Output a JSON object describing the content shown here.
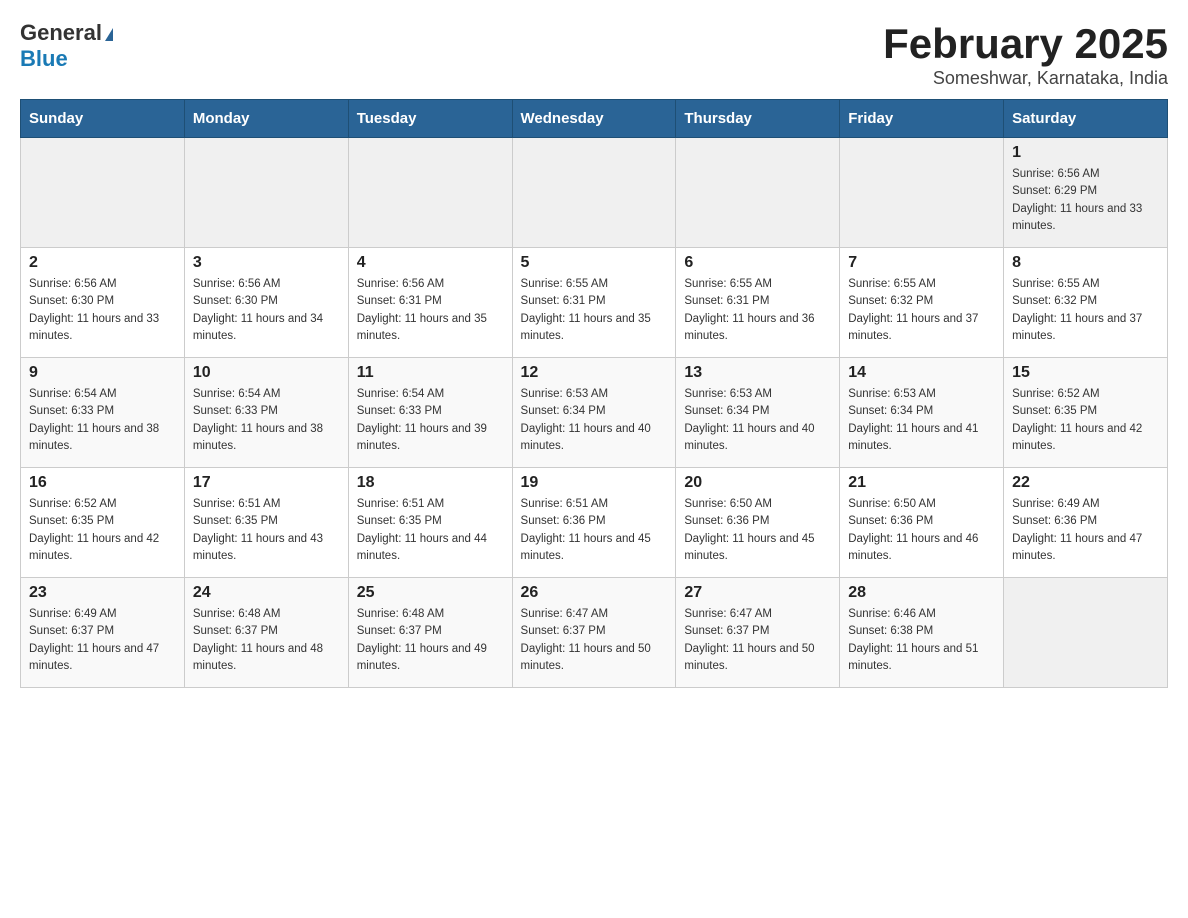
{
  "logo": {
    "general": "General",
    "blue": "Blue"
  },
  "title": "February 2025",
  "location": "Someshwar, Karnataka, India",
  "days_of_week": [
    "Sunday",
    "Monday",
    "Tuesday",
    "Wednesday",
    "Thursday",
    "Friday",
    "Saturday"
  ],
  "weeks": [
    [
      {
        "num": "",
        "info": ""
      },
      {
        "num": "",
        "info": ""
      },
      {
        "num": "",
        "info": ""
      },
      {
        "num": "",
        "info": ""
      },
      {
        "num": "",
        "info": ""
      },
      {
        "num": "",
        "info": ""
      },
      {
        "num": "1",
        "info": "Sunrise: 6:56 AM\nSunset: 6:29 PM\nDaylight: 11 hours and 33 minutes."
      }
    ],
    [
      {
        "num": "2",
        "info": "Sunrise: 6:56 AM\nSunset: 6:30 PM\nDaylight: 11 hours and 33 minutes."
      },
      {
        "num": "3",
        "info": "Sunrise: 6:56 AM\nSunset: 6:30 PM\nDaylight: 11 hours and 34 minutes."
      },
      {
        "num": "4",
        "info": "Sunrise: 6:56 AM\nSunset: 6:31 PM\nDaylight: 11 hours and 35 minutes."
      },
      {
        "num": "5",
        "info": "Sunrise: 6:55 AM\nSunset: 6:31 PM\nDaylight: 11 hours and 35 minutes."
      },
      {
        "num": "6",
        "info": "Sunrise: 6:55 AM\nSunset: 6:31 PM\nDaylight: 11 hours and 36 minutes."
      },
      {
        "num": "7",
        "info": "Sunrise: 6:55 AM\nSunset: 6:32 PM\nDaylight: 11 hours and 37 minutes."
      },
      {
        "num": "8",
        "info": "Sunrise: 6:55 AM\nSunset: 6:32 PM\nDaylight: 11 hours and 37 minutes."
      }
    ],
    [
      {
        "num": "9",
        "info": "Sunrise: 6:54 AM\nSunset: 6:33 PM\nDaylight: 11 hours and 38 minutes."
      },
      {
        "num": "10",
        "info": "Sunrise: 6:54 AM\nSunset: 6:33 PM\nDaylight: 11 hours and 38 minutes."
      },
      {
        "num": "11",
        "info": "Sunrise: 6:54 AM\nSunset: 6:33 PM\nDaylight: 11 hours and 39 minutes."
      },
      {
        "num": "12",
        "info": "Sunrise: 6:53 AM\nSunset: 6:34 PM\nDaylight: 11 hours and 40 minutes."
      },
      {
        "num": "13",
        "info": "Sunrise: 6:53 AM\nSunset: 6:34 PM\nDaylight: 11 hours and 40 minutes."
      },
      {
        "num": "14",
        "info": "Sunrise: 6:53 AM\nSunset: 6:34 PM\nDaylight: 11 hours and 41 minutes."
      },
      {
        "num": "15",
        "info": "Sunrise: 6:52 AM\nSunset: 6:35 PM\nDaylight: 11 hours and 42 minutes."
      }
    ],
    [
      {
        "num": "16",
        "info": "Sunrise: 6:52 AM\nSunset: 6:35 PM\nDaylight: 11 hours and 42 minutes."
      },
      {
        "num": "17",
        "info": "Sunrise: 6:51 AM\nSunset: 6:35 PM\nDaylight: 11 hours and 43 minutes."
      },
      {
        "num": "18",
        "info": "Sunrise: 6:51 AM\nSunset: 6:35 PM\nDaylight: 11 hours and 44 minutes."
      },
      {
        "num": "19",
        "info": "Sunrise: 6:51 AM\nSunset: 6:36 PM\nDaylight: 11 hours and 45 minutes."
      },
      {
        "num": "20",
        "info": "Sunrise: 6:50 AM\nSunset: 6:36 PM\nDaylight: 11 hours and 45 minutes."
      },
      {
        "num": "21",
        "info": "Sunrise: 6:50 AM\nSunset: 6:36 PM\nDaylight: 11 hours and 46 minutes."
      },
      {
        "num": "22",
        "info": "Sunrise: 6:49 AM\nSunset: 6:36 PM\nDaylight: 11 hours and 47 minutes."
      }
    ],
    [
      {
        "num": "23",
        "info": "Sunrise: 6:49 AM\nSunset: 6:37 PM\nDaylight: 11 hours and 47 minutes."
      },
      {
        "num": "24",
        "info": "Sunrise: 6:48 AM\nSunset: 6:37 PM\nDaylight: 11 hours and 48 minutes."
      },
      {
        "num": "25",
        "info": "Sunrise: 6:48 AM\nSunset: 6:37 PM\nDaylight: 11 hours and 49 minutes."
      },
      {
        "num": "26",
        "info": "Sunrise: 6:47 AM\nSunset: 6:37 PM\nDaylight: 11 hours and 50 minutes."
      },
      {
        "num": "27",
        "info": "Sunrise: 6:47 AM\nSunset: 6:37 PM\nDaylight: 11 hours and 50 minutes."
      },
      {
        "num": "28",
        "info": "Sunrise: 6:46 AM\nSunset: 6:38 PM\nDaylight: 11 hours and 51 minutes."
      },
      {
        "num": "",
        "info": ""
      }
    ]
  ]
}
